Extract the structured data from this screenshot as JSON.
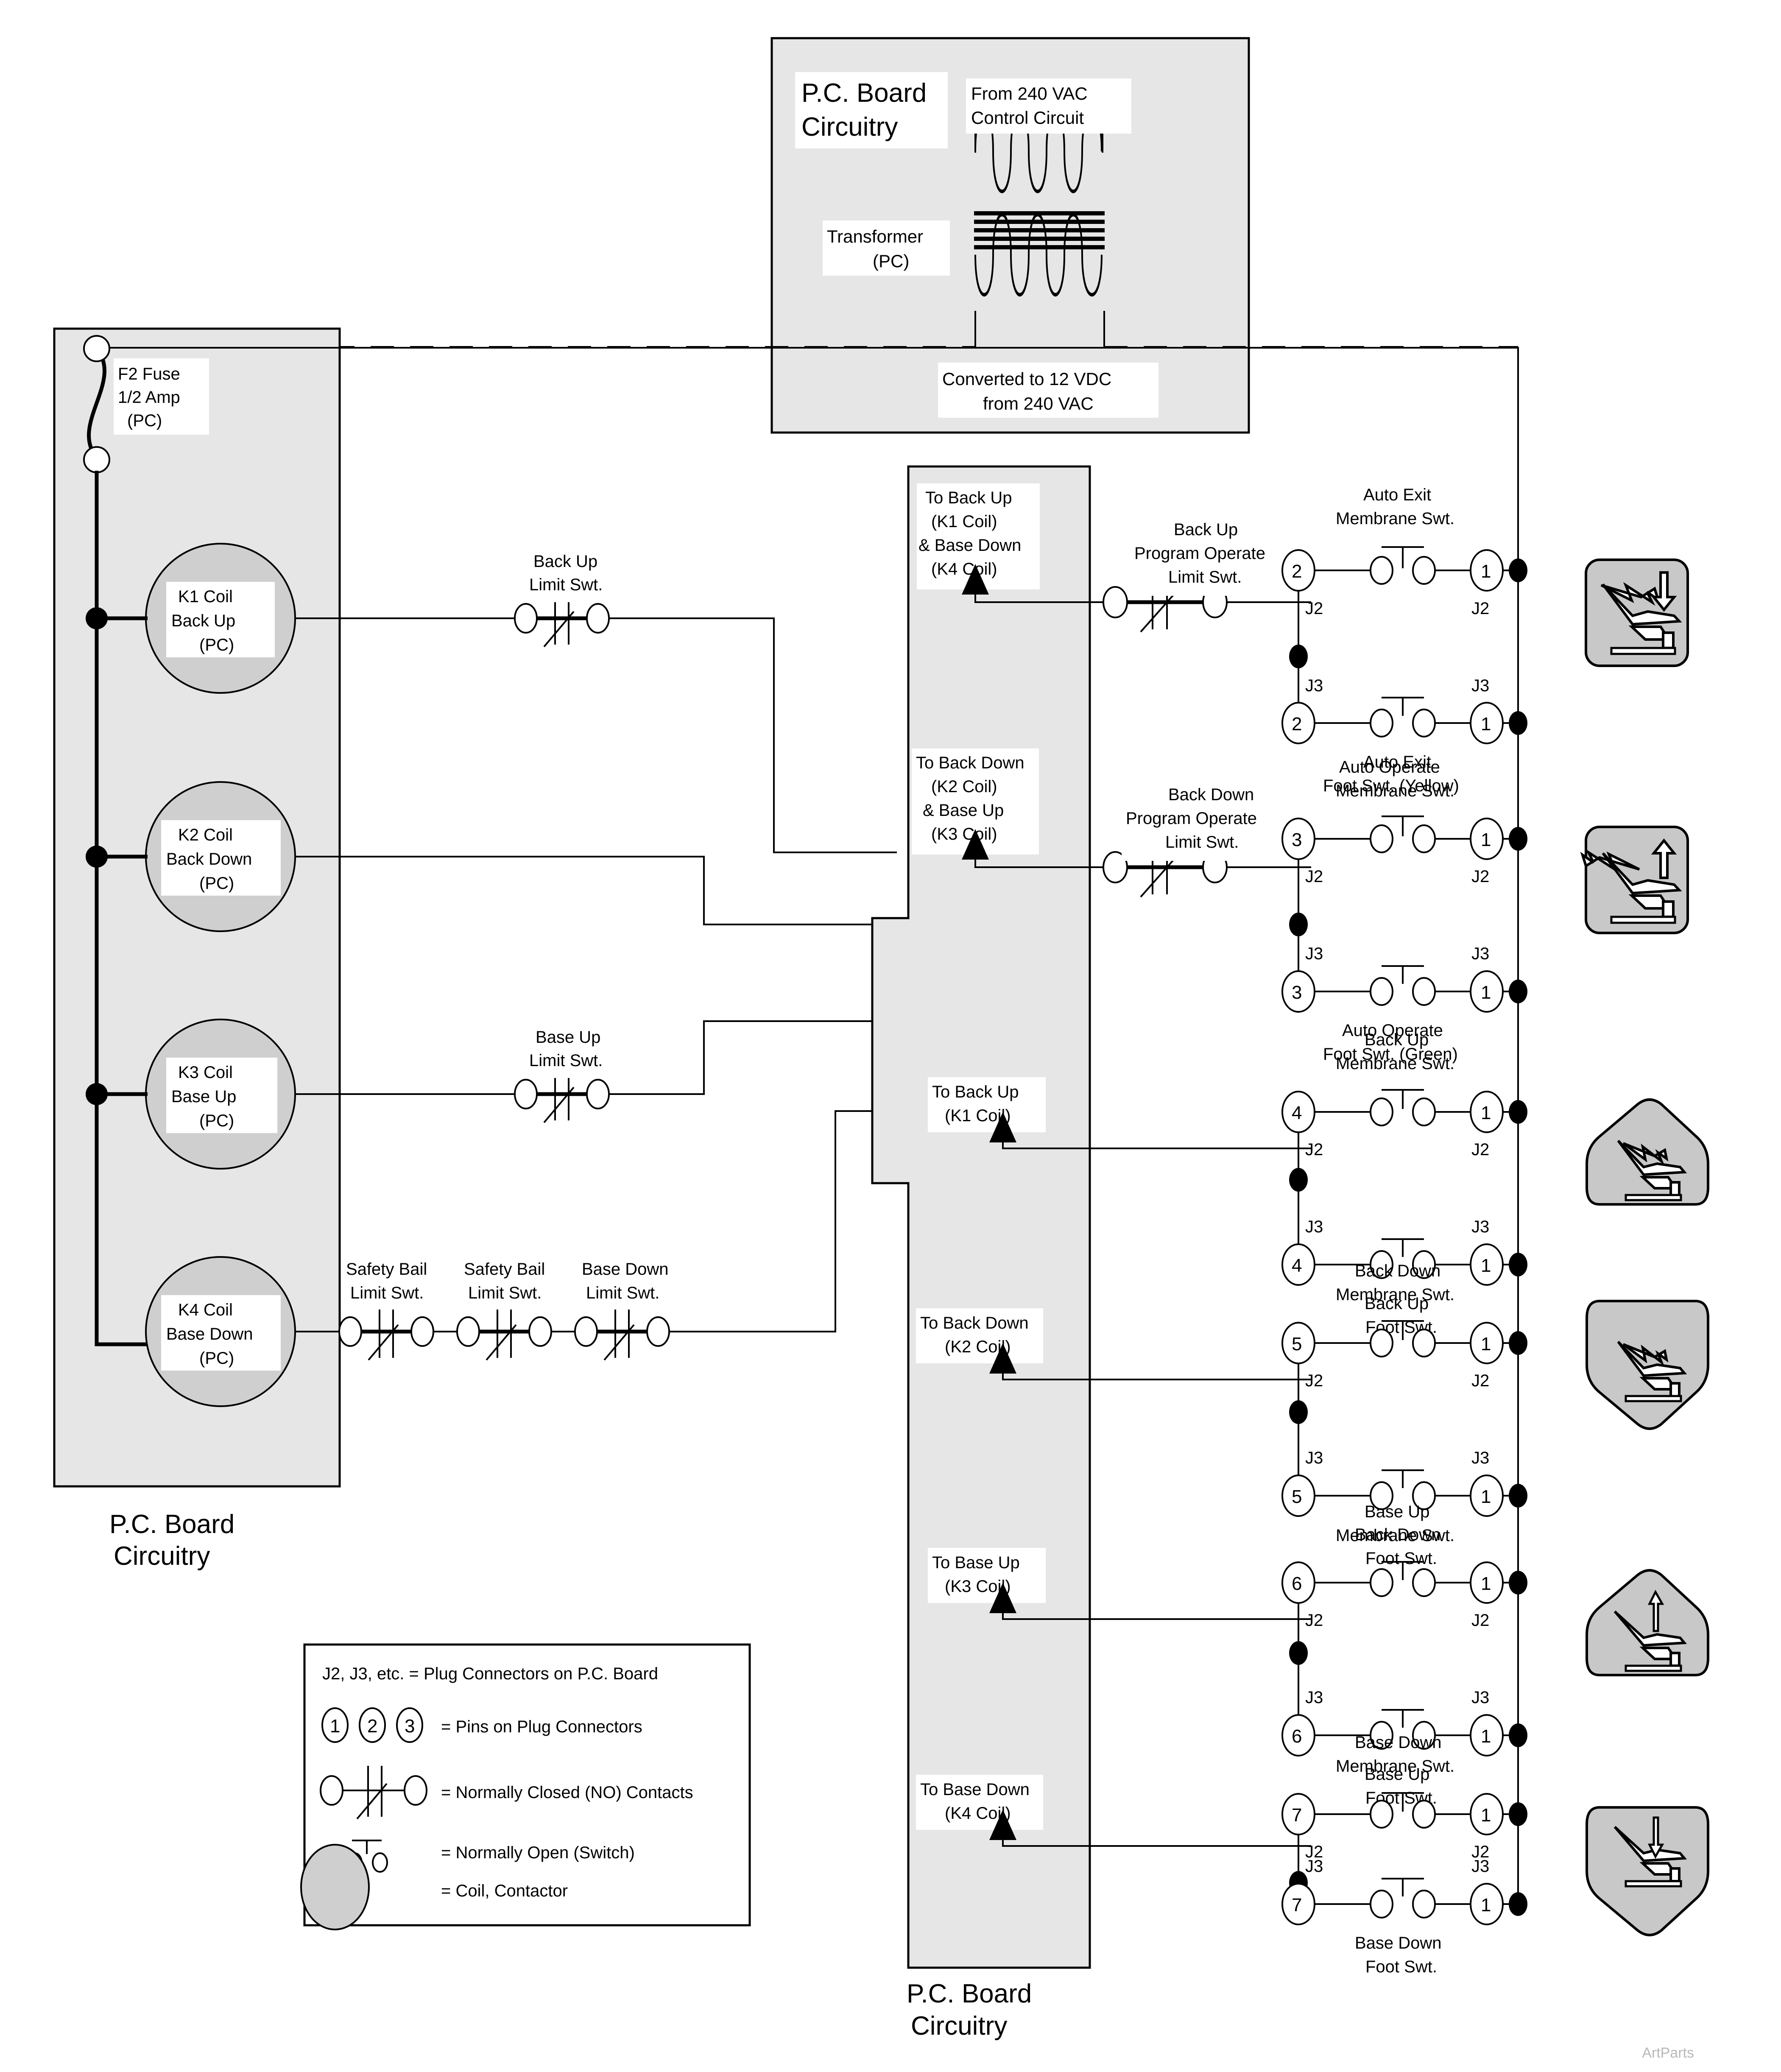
{
  "title_top_panel": {
    "line1": "P.C. Board",
    "line2": "Circuitry"
  },
  "transformer": {
    "source_label_l1": "From 240 VAC",
    "source_label_l2": "Control Circuit",
    "name_l1": "Transformer",
    "name_l2": "(PC)",
    "output_l1": "Converted to 12 VDC",
    "output_l2": "from 240 VAC"
  },
  "left_panel": {
    "caption_l1": "P.C. Board",
    "caption_l2": "Circuitry",
    "fuse": {
      "l1": "F2 Fuse",
      "l2": "1/2 Amp",
      "l3": "(PC)"
    },
    "coils": [
      {
        "l1": "K1 Coil",
        "l2": "Back Up",
        "l3": "(PC)"
      },
      {
        "l1": "K2 Coil",
        "l2": "Back Down",
        "l3": "(PC)"
      },
      {
        "l1": "K3 Coil",
        "l2": "Base Up",
        "l3": "(PC)"
      },
      {
        "l1": "K4 Coil",
        "l2": "Base Down",
        "l3": "(PC)"
      }
    ],
    "limit_switches": [
      {
        "l1": "Back Up",
        "l2": "Limit Swt."
      },
      {
        "l1": "Base Up",
        "l2": "Limit Swt."
      },
      {
        "l1": "Safety Bail",
        "l2": "Limit Swt."
      },
      {
        "l1": "Safety Bail",
        "l2": "Limit Swt."
      },
      {
        "l1": "Base Down",
        "l2": "Limit Swt."
      }
    ]
  },
  "mid_panel": {
    "caption_l1": "P.C. Board",
    "caption_l2": "Circuitry",
    "targets": [
      {
        "l1": "To Back Up",
        "l2": "(K1 Coil)",
        "l3": "& Base Down",
        "l4": "(K4 Coil)"
      },
      {
        "l1": "To Back Down",
        "l2": "(K2 Coil)",
        "l3": "& Base Up",
        "l4": "(K3 Coil)"
      },
      {
        "l1": "To Back Up",
        "l2": "(K1 Coil)",
        "l3": "",
        "l4": ""
      },
      {
        "l1": "To Back Down",
        "l2": "(K2 Coil)",
        "l3": "",
        "l4": ""
      },
      {
        "l1": "To Base Up",
        "l2": "(K3 Coil)",
        "l3": "",
        "l4": ""
      },
      {
        "l1": "To Base Down",
        "l2": "(K4 Coil)",
        "l3": "",
        "l4": ""
      }
    ],
    "program_limit_switches": [
      {
        "l1": "Back Up",
        "l2": "Program Operate",
        "l3": "Limit Swt."
      },
      {
        "l1": "Back Down",
        "l2": "Program Operate",
        "l3": "Limit Swt."
      }
    ]
  },
  "switch_rows": [
    {
      "top_label_l1": "Auto Exit",
      "top_label_l2": "Membrane Swt.",
      "bottom_label_l1": "Auto Exit",
      "bottom_label_l2": "Foot Swt. (Yellow)",
      "left_pin_top": "2",
      "right_pin_top": "1",
      "left_pin_bottom": "2",
      "right_pin_bottom": "1",
      "conn_top_left": "J2",
      "conn_top_right": "J2",
      "conn_bottom_left": "J3",
      "conn_bottom_right": "J3",
      "icon": "chair-auto-exit",
      "icon_shape": "rounded",
      "icon_arrow": "down"
    },
    {
      "top_label_l1": "Auto  Operate",
      "top_label_l2": "Membrane Swt.",
      "bottom_label_l1": "Auto Operate",
      "bottom_label_l2": "Foot Swt. (Green)",
      "left_pin_top": "3",
      "right_pin_top": "1",
      "left_pin_bottom": "3",
      "right_pin_bottom": "1",
      "conn_top_left": "J2",
      "conn_top_right": "J2",
      "conn_bottom_left": "J3",
      "conn_bottom_right": "J3",
      "icon": "chair-auto-operate",
      "icon_shape": "rounded",
      "icon_arrow": "up"
    },
    {
      "top_label_l1": "Back Up",
      "top_label_l2": "Membrane Swt.",
      "bottom_label_l1": "Back Up",
      "bottom_label_l2": "Foot Swt.",
      "left_pin_top": "4",
      "right_pin_top": "1",
      "left_pin_bottom": "4",
      "right_pin_bottom": "1",
      "conn_top_left": "J2",
      "conn_top_right": "J2",
      "conn_bottom_left": "J3",
      "conn_bottom_right": "J3",
      "icon": "chair-back-up",
      "icon_shape": "shield-up",
      "icon_arrow": "back-up"
    },
    {
      "top_label_l1": "Back Down",
      "top_label_l2": "Membrane Swt.",
      "bottom_label_l1": "Back Down",
      "bottom_label_l2": "Foot Swt.",
      "left_pin_top": "5",
      "right_pin_top": "1",
      "left_pin_bottom": "5",
      "right_pin_bottom": "1",
      "conn_top_left": "J2",
      "conn_top_right": "J2",
      "conn_bottom_left": "J3",
      "conn_bottom_right": "J3",
      "icon": "chair-back-down",
      "icon_shape": "shield-down",
      "icon_arrow": "back-down"
    },
    {
      "top_label_l1": "Base Up",
      "top_label_l2": "Membrane Swt.",
      "bottom_label_l1": "Base Up",
      "bottom_label_l2": "Foot Swt.",
      "left_pin_top": "6",
      "right_pin_top": "1",
      "left_pin_bottom": "6",
      "right_pin_bottom": "1",
      "conn_top_left": "J2",
      "conn_top_right": "J2",
      "conn_bottom_left": "J3",
      "conn_bottom_right": "J3",
      "icon": "chair-base-up",
      "icon_shape": "shield-up",
      "icon_arrow": "up"
    },
    {
      "top_label_l1": "Base Down",
      "top_label_l2": "Membrane Swt.",
      "bottom_label_l1": "Base Down",
      "bottom_label_l2": "Foot Swt.",
      "left_pin_top": "7",
      "right_pin_top": "1",
      "left_pin_bottom": "7",
      "right_pin_bottom": "1",
      "conn_top_left": "J2",
      "conn_top_right": "J2",
      "conn_bottom_left": "J3",
      "conn_bottom_right": "J3",
      "icon": "chair-base-down",
      "icon_shape": "shield-down",
      "icon_arrow": "down"
    }
  ],
  "legend": {
    "line_connectors": "J2, J3, etc. = Plug Connectors on P.C. Board",
    "pins_1": "1",
    "pins_2": "2",
    "pins_3": "3",
    "line_pins": "= Pins on Plug Connectors",
    "line_nc": "= Normally Closed (NO) Contacts",
    "line_no": "= Normally Open (Switch)",
    "line_coil": "= Coil, Contactor"
  },
  "watermark": "ArtParts"
}
